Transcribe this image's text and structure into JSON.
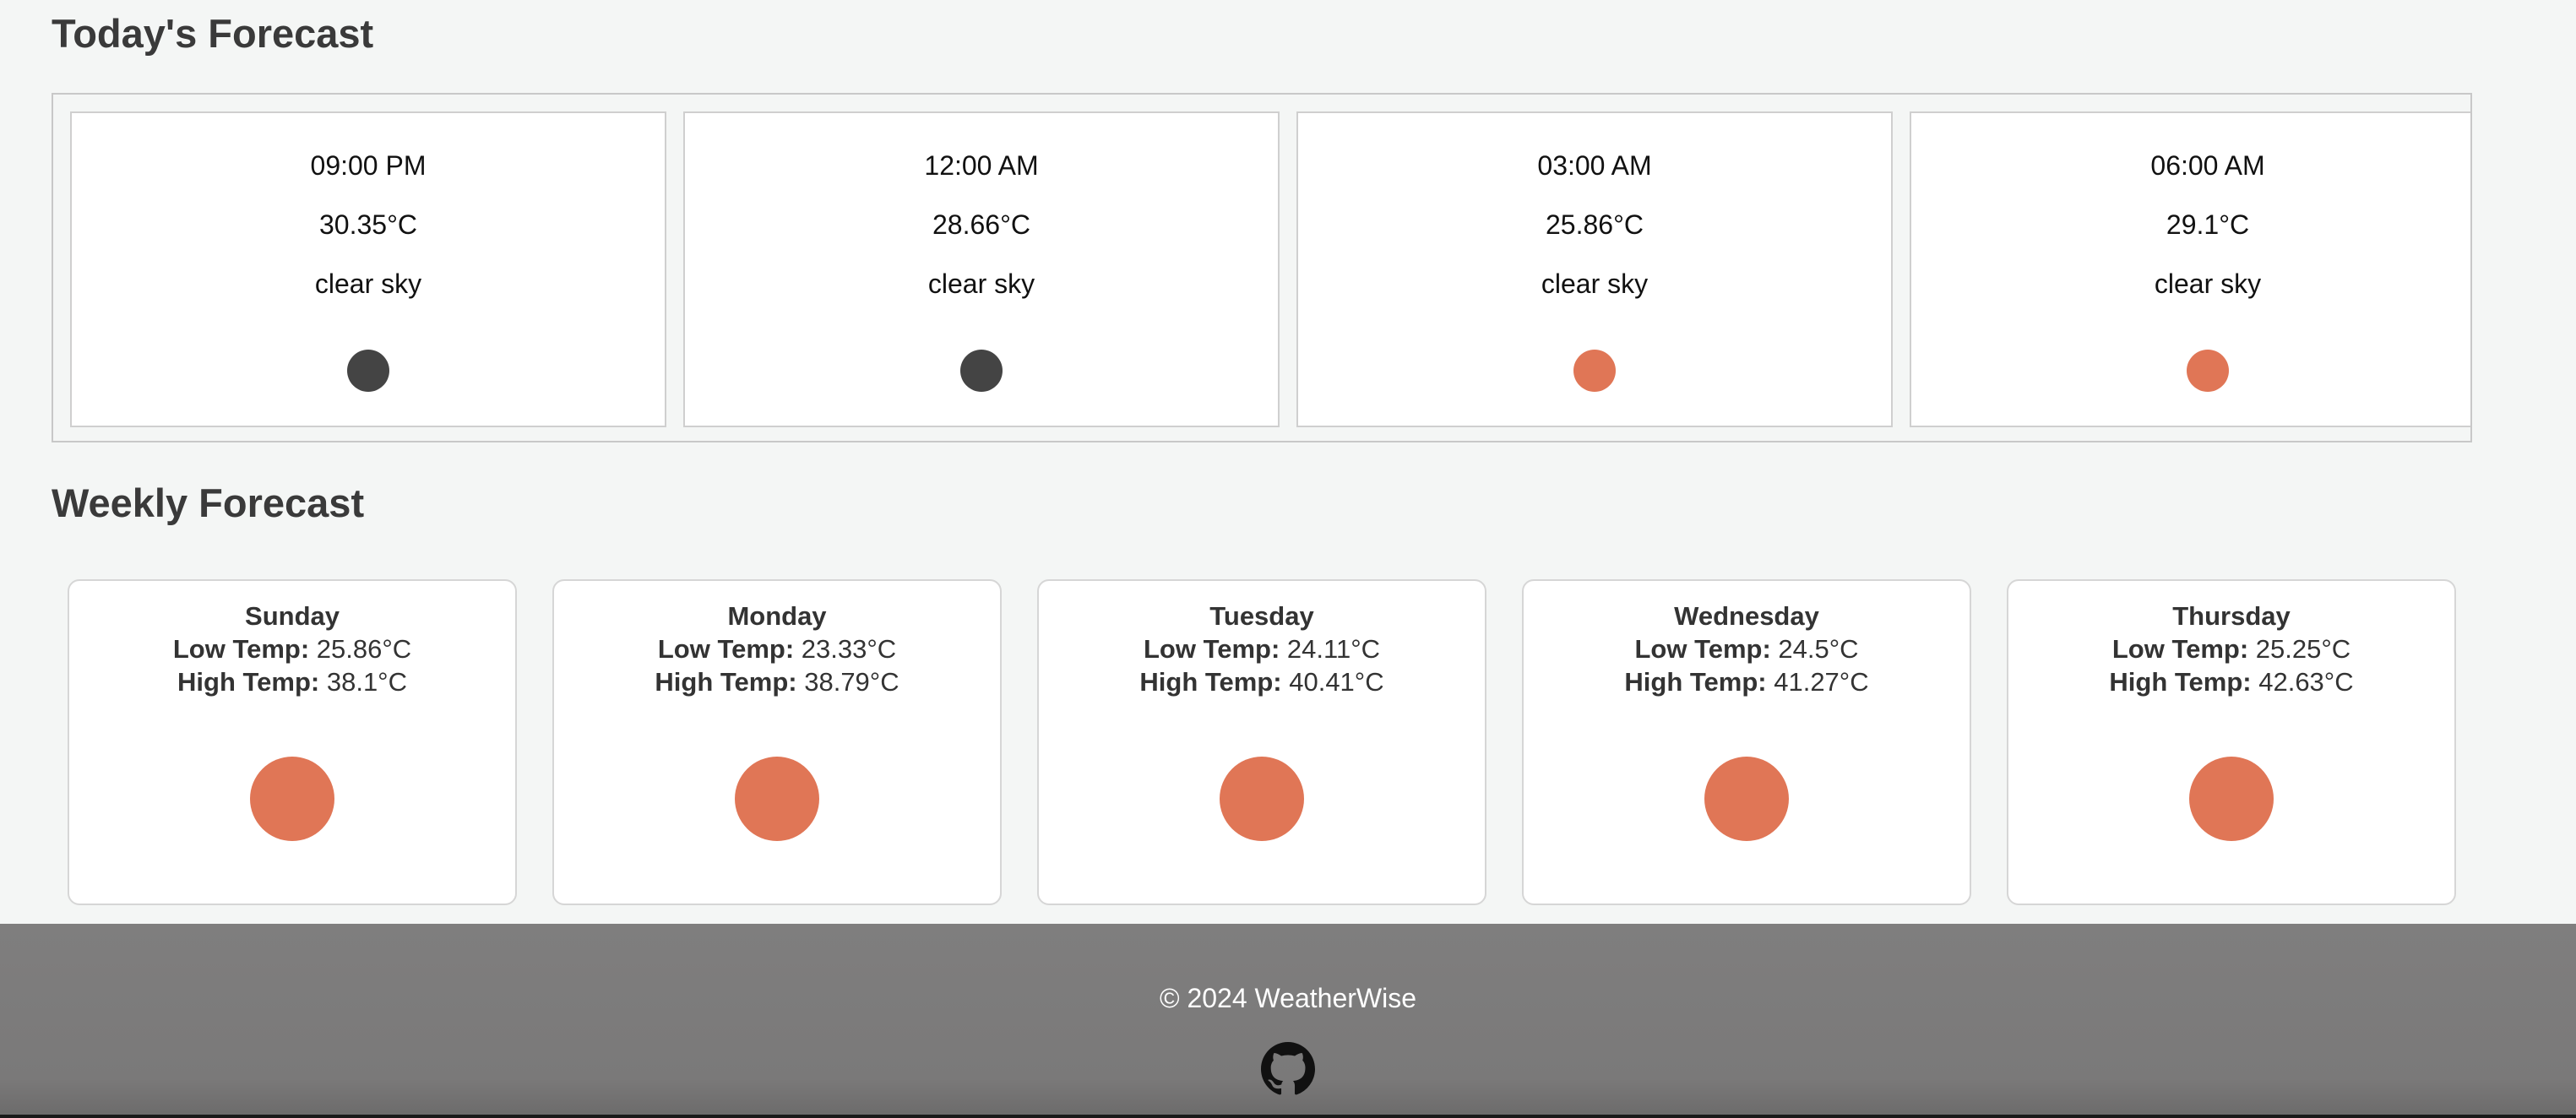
{
  "today": {
    "title": "Today's Forecast",
    "hours": [
      {
        "time": "09:00 PM",
        "temp": "30.35°C",
        "description": "clear sky",
        "icon": "moon-icon",
        "icon_color": "#444444"
      },
      {
        "time": "12:00 AM",
        "temp": "28.66°C",
        "description": "clear sky",
        "icon": "moon-icon",
        "icon_color": "#444444"
      },
      {
        "time": "03:00 AM",
        "temp": "25.86°C",
        "description": "clear sky",
        "icon": "sun-icon",
        "icon_color": "#e07656"
      },
      {
        "time": "06:00 AM",
        "temp": "29.1°C",
        "description": "clear sky",
        "icon": "sun-icon",
        "icon_color": "#e07656"
      }
    ]
  },
  "weekly": {
    "title": "Weekly Forecast",
    "low_label": "Low Temp:",
    "high_label": "High Temp:",
    "days": [
      {
        "day": "Sunday",
        "low": "25.86°C",
        "high": "38.1°C",
        "icon": "sun-icon",
        "icon_color": "#e07656"
      },
      {
        "day": "Monday",
        "low": "23.33°C",
        "high": "38.79°C",
        "icon": "sun-icon",
        "icon_color": "#e07656"
      },
      {
        "day": "Tuesday",
        "low": "24.11°C",
        "high": "40.41°C",
        "icon": "sun-icon",
        "icon_color": "#e07656"
      },
      {
        "day": "Wednesday",
        "low": "24.5°C",
        "high": "41.27°C",
        "icon": "sun-icon",
        "icon_color": "#e07656"
      },
      {
        "day": "Thursday",
        "low": "25.25°C",
        "high": "42.63°C",
        "icon": "sun-icon",
        "icon_color": "#e07656"
      }
    ]
  },
  "footer": {
    "copyright": "© 2024 WeatherWise",
    "icon": "github-icon"
  }
}
